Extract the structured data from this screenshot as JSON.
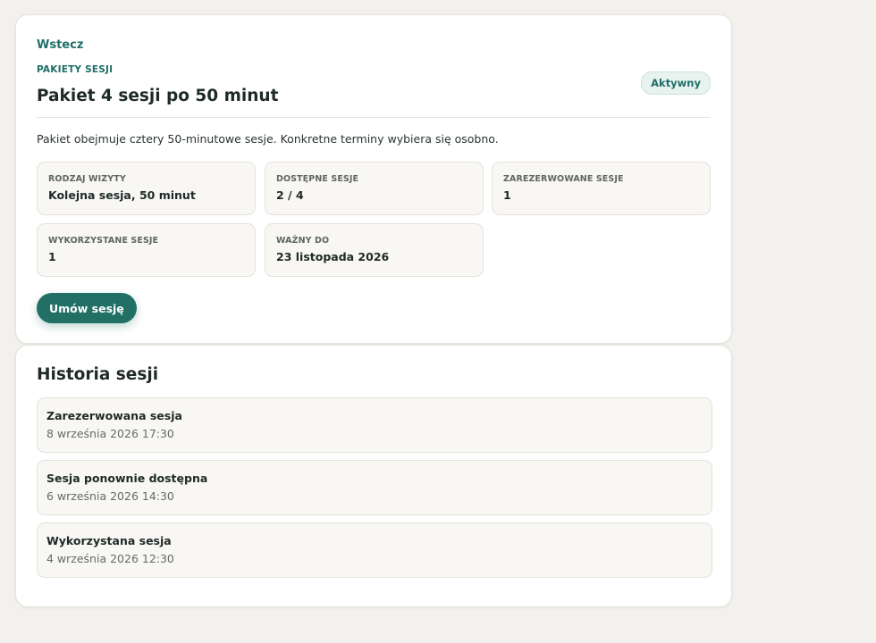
{
  "navigation": {
    "back_label": "Wstecz"
  },
  "package": {
    "eyebrow": "PAKIETY SESJI",
    "title": "Pakiet 4 sesji po 50 minut",
    "status_badge": "Aktywny",
    "description": "Pakiet obejmuje cztery 50-minutowe sesje. Konkretne terminy wybiera się osobno.",
    "details": [
      {
        "label": "RODZAJ WIZYTY",
        "value": "Kolejna sesja, 50 minut"
      },
      {
        "label": "DOSTĘPNE SESJE",
        "value": "2 / 4"
      },
      {
        "label": "ZAREZERWOWANE SESJE",
        "value": "1"
      },
      {
        "label": "WYKORZYSTANE SESJE",
        "value": "1"
      },
      {
        "label": "WAŻNY DO",
        "value": "23 listopada 2026"
      }
    ],
    "book_button_label": "Umów sesję"
  },
  "history": {
    "title": "Historia sesji",
    "items": [
      {
        "title": "Zarezerwowana sesja",
        "time": "8 września 2026 17:30"
      },
      {
        "title": "Sesja ponownie dostępna",
        "time": "6 września 2026 14:30"
      },
      {
        "title": "Wykorzystana sesja",
        "time": "4 września 2026 12:30"
      }
    ]
  },
  "colors": {
    "accent": "#1f6f68",
    "button": "#226f66",
    "badge_bg": "#e8f3f0",
    "page_bg": "#f2f1ed"
  }
}
